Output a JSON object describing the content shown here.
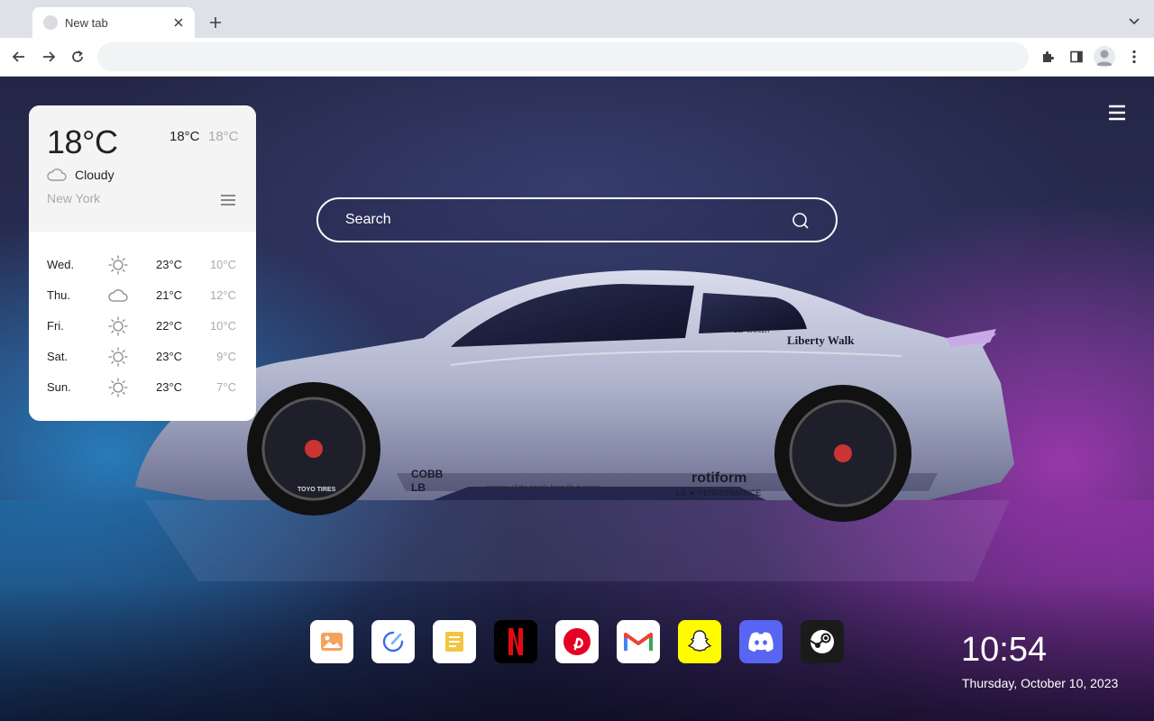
{
  "browser": {
    "tab": {
      "title": "New tab"
    },
    "omnibox": {
      "value": ""
    }
  },
  "weather": {
    "current_temp": "18°C",
    "high": "18°C",
    "low": "18°C",
    "condition": "Cloudy",
    "condition_icon": "cloud-icon",
    "city": "New York",
    "forecast": [
      {
        "day": "Wed.",
        "icon": "sun-icon",
        "high": "23°C",
        "low": "10°C"
      },
      {
        "day": "Thu.",
        "icon": "cloud-icon",
        "high": "21°C",
        "low": "12°C"
      },
      {
        "day": "Fri.",
        "icon": "sun-icon",
        "high": "22°C",
        "low": "10°C"
      },
      {
        "day": "Sat.",
        "icon": "sun-icon",
        "high": "23°C",
        "low": "9°C"
      },
      {
        "day": "Sun.",
        "icon": "sun-icon",
        "high": "23°C",
        "low": "7°C"
      }
    ]
  },
  "search": {
    "placeholder": "Search"
  },
  "dock": [
    {
      "name": "gallery",
      "icon": "image-icon",
      "color": "#ffffff"
    },
    {
      "name": "edit",
      "icon": "edit-icon",
      "color": "#ffffff"
    },
    {
      "name": "notes",
      "icon": "notes-icon",
      "color": "#ffffff"
    },
    {
      "name": "netflix",
      "icon": "netflix-icon",
      "color": "#000000"
    },
    {
      "name": "pinterest",
      "icon": "pinterest-icon",
      "color": "#ffffff"
    },
    {
      "name": "gmail",
      "icon": "gmail-icon",
      "color": "#ffffff"
    },
    {
      "name": "snapchat",
      "icon": "snapchat-icon",
      "color": "#fffc00"
    },
    {
      "name": "discord",
      "icon": "discord-icon",
      "color": "#5865f2"
    },
    {
      "name": "steam",
      "icon": "steam-icon",
      "color": "#1b1b1b"
    }
  ],
  "clock": {
    "time": "10:54",
    "date": "Thursday, October 10, 2023"
  },
  "wallpaper": {
    "car_text": {
      "brand": "Liberty Walk",
      "sticker": "SuPerfrezh",
      "wheel_brand": "rotiform",
      "lb_performance": "LB ★ PERFORMANCE",
      "cobb": "COBB",
      "lb_works": "LB",
      "tagline": "Imagine all the people living life in peace",
      "tire": "TOYO TIRES"
    }
  }
}
